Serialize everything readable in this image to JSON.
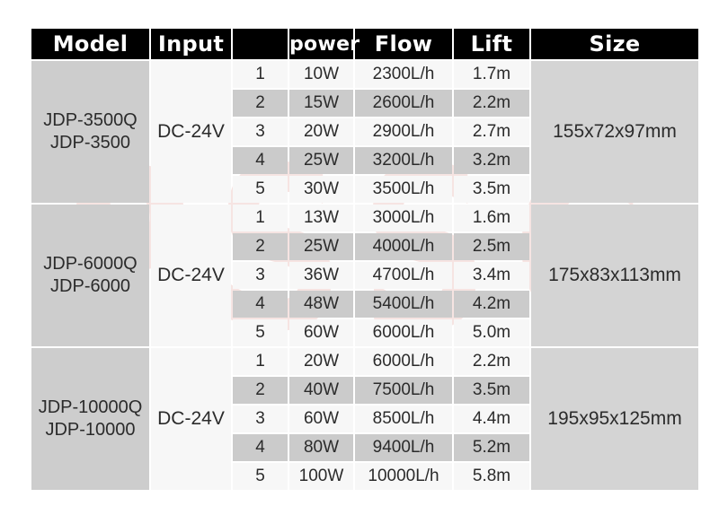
{
  "watermark": {
    "text": "PSSC",
    "color": "#c0392b"
  },
  "table": {
    "headers": {
      "model": "Model",
      "input": "Input",
      "stage": "",
      "power": "power",
      "flow": "Flow",
      "lift": "Lift",
      "size": "Size"
    },
    "groups": [
      {
        "model_line1": "JDP-3500Q",
        "model_line2": "JDP-3500",
        "input": "DC-24V",
        "size": "155x72x97mm",
        "rows": [
          {
            "stage": "1",
            "power": "10W",
            "flow": "2300L/h",
            "lift": "1.7m"
          },
          {
            "stage": "2",
            "power": "15W",
            "flow": "2600L/h",
            "lift": "2.2m"
          },
          {
            "stage": "3",
            "power": "20W",
            "flow": "2900L/h",
            "lift": "2.7m"
          },
          {
            "stage": "4",
            "power": "25W",
            "flow": "3200L/h",
            "lift": "3.2m"
          },
          {
            "stage": "5",
            "power": "30W",
            "flow": "3500L/h",
            "lift": "3.5m"
          }
        ]
      },
      {
        "model_line1": "JDP-6000Q",
        "model_line2": "JDP-6000",
        "input": "DC-24V",
        "size": "175x83x113mm",
        "rows": [
          {
            "stage": "1",
            "power": "13W",
            "flow": "3000L/h",
            "lift": "1.6m"
          },
          {
            "stage": "2",
            "power": "25W",
            "flow": "4000L/h",
            "lift": "2.5m"
          },
          {
            "stage": "3",
            "power": "36W",
            "flow": "4700L/h",
            "lift": "3.4m"
          },
          {
            "stage": "4",
            "power": "48W",
            "flow": "5400L/h",
            "lift": "4.2m"
          },
          {
            "stage": "5",
            "power": "60W",
            "flow": "6000L/h",
            "lift": "5.0m"
          }
        ]
      },
      {
        "model_line1": "JDP-10000Q",
        "model_line2": "JDP-10000",
        "input": "DC-24V",
        "size": "195x95x125mm",
        "rows": [
          {
            "stage": "1",
            "power": "20W",
            "flow": "6000L/h",
            "lift": "2.2m"
          },
          {
            "stage": "2",
            "power": "40W",
            "flow": "7500L/h",
            "lift": "3.5m"
          },
          {
            "stage": "3",
            "power": "60W",
            "flow": "8500L/h",
            "lift": "4.4m"
          },
          {
            "stage": "4",
            "power": "80W",
            "flow": "9400L/h",
            "lift": "5.2m"
          },
          {
            "stage": "5",
            "power": "100W",
            "flow": "10000L/h",
            "lift": "5.8m"
          }
        ]
      }
    ]
  }
}
